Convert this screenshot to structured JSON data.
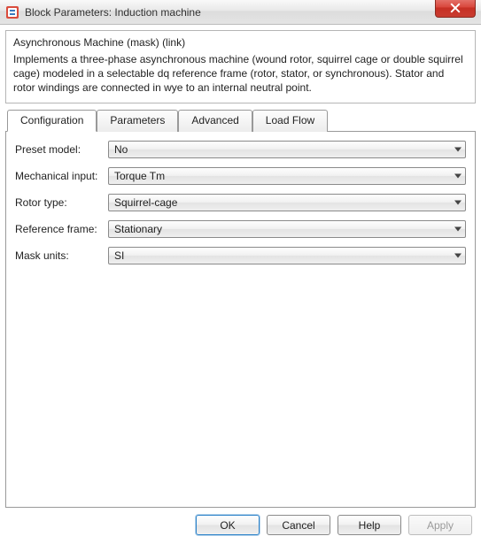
{
  "window": {
    "title": "Block Parameters: Induction machine"
  },
  "mask": {
    "heading": "Asynchronous Machine (mask) (link)",
    "description": "Implements a three-phase asynchronous machine (wound rotor, squirrel cage or double squirrel cage) modeled in a selectable dq reference frame (rotor, stator, or synchronous). Stator and rotor windings are connected in wye to an internal neutral point."
  },
  "tabs": [
    {
      "label": "Configuration",
      "active": true
    },
    {
      "label": "Parameters",
      "active": false
    },
    {
      "label": "Advanced",
      "active": false
    },
    {
      "label": "Load Flow",
      "active": false
    }
  ],
  "fields": {
    "preset_model": {
      "label": "Preset model:",
      "value": "No"
    },
    "mechanical_input": {
      "label": "Mechanical input:",
      "value": "Torque Tm"
    },
    "rotor_type": {
      "label": "Rotor type:",
      "value": "Squirrel-cage"
    },
    "reference_frame": {
      "label": "Reference frame:",
      "value": "Stationary"
    },
    "mask_units": {
      "label": "Mask units:",
      "value": "SI"
    }
  },
  "buttons": {
    "ok": "OK",
    "cancel": "Cancel",
    "help": "Help",
    "apply": "Apply"
  }
}
